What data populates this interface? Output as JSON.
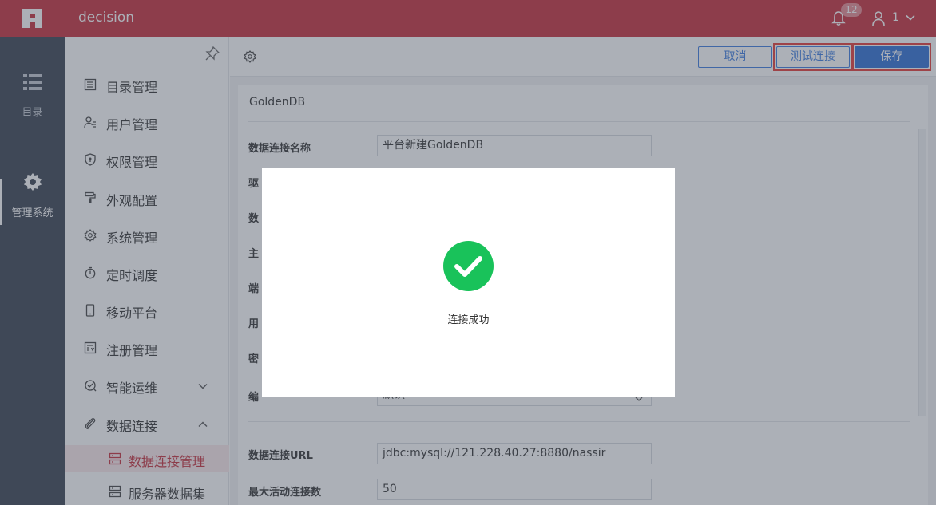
{
  "header": {
    "app_title": "decision",
    "notification_count": "12",
    "user_name": "1",
    "brand_color": "#c62e3b"
  },
  "leftnav": {
    "items": [
      {
        "label": "目录",
        "icon": "list-icon"
      },
      {
        "label": "管理系统",
        "icon": "gear-icon",
        "active": true
      }
    ]
  },
  "submenu": {
    "items": [
      {
        "label": "目录管理",
        "icon": "catalog-icon"
      },
      {
        "label": "用户管理",
        "icon": "user-manage-icon"
      },
      {
        "label": "权限管理",
        "icon": "shield-icon"
      },
      {
        "label": "外观配置",
        "icon": "paint-roller-icon"
      },
      {
        "label": "系统管理",
        "icon": "gear-icon"
      },
      {
        "label": "定时调度",
        "icon": "stopwatch-icon"
      },
      {
        "label": "移动平台",
        "icon": "phone-icon"
      },
      {
        "label": "注册管理",
        "icon": "register-icon"
      },
      {
        "label": "智能运维",
        "icon": "ops-icon",
        "expandable": true,
        "expanded": false
      },
      {
        "label": "数据连接",
        "icon": "paperclip-icon",
        "expandable": true,
        "expanded": true
      },
      {
        "label": "数据连接管理",
        "icon": "server-icon",
        "selected": true
      },
      {
        "label": "服务器数据集",
        "icon": "server-icon"
      }
    ]
  },
  "toolbar": {
    "cancel_label": "取消",
    "test_label": "测试连接",
    "save_label": "保存"
  },
  "form": {
    "title": "GoldenDB",
    "fields": [
      {
        "label": "数据连接名称",
        "value": "平台新建GoldenDB"
      },
      {
        "label": "驱",
        "value": ""
      },
      {
        "label": "数",
        "value": ""
      },
      {
        "label": "主",
        "value": ""
      },
      {
        "label": "端",
        "value": ""
      },
      {
        "label": "用",
        "value": ""
      },
      {
        "label": "密",
        "value": ""
      },
      {
        "label": "编",
        "value": "默认"
      },
      {
        "label": "数据连接URL",
        "value": "jdbc:mysql://121.228.40.27:8880/nassir"
      },
      {
        "label": "最大活动连接数",
        "value": "50"
      }
    ]
  },
  "modal": {
    "message": "连接成功",
    "icon": "check-circle-icon",
    "success_color": "#19c25a"
  }
}
